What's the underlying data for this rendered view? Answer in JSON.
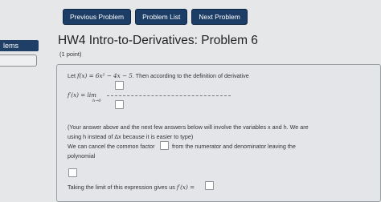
{
  "sidebar": {
    "tab_label": "lems"
  },
  "nav": {
    "previous": "Previous Problem",
    "list": "Problem List",
    "next": "Next Problem"
  },
  "problem": {
    "title": "HW4 Intro-to-Derivatives: Problem 6",
    "points": "(1 point)",
    "line1_prefix": "Let ",
    "line1_func": "f(x) = 6x² − 4x − 5",
    "line1_suffix": ". Then according to the definition of derivative",
    "derivative_lhs": "f′(x) = lim",
    "limit_sub": "h→0",
    "note1": "(Your answer above and the next few answers below will involve the variables x and h. We are",
    "note2": "using h instead of Δx because it is easier to type)",
    "cancel_prefix": "We can cancel the common factor",
    "cancel_suffix": "from the numerator and denominator leaving the",
    "polynomial": "polynomial",
    "final_prefix": "Taking the limit of this expression gives us ",
    "final_func": "f′(x) ="
  }
}
